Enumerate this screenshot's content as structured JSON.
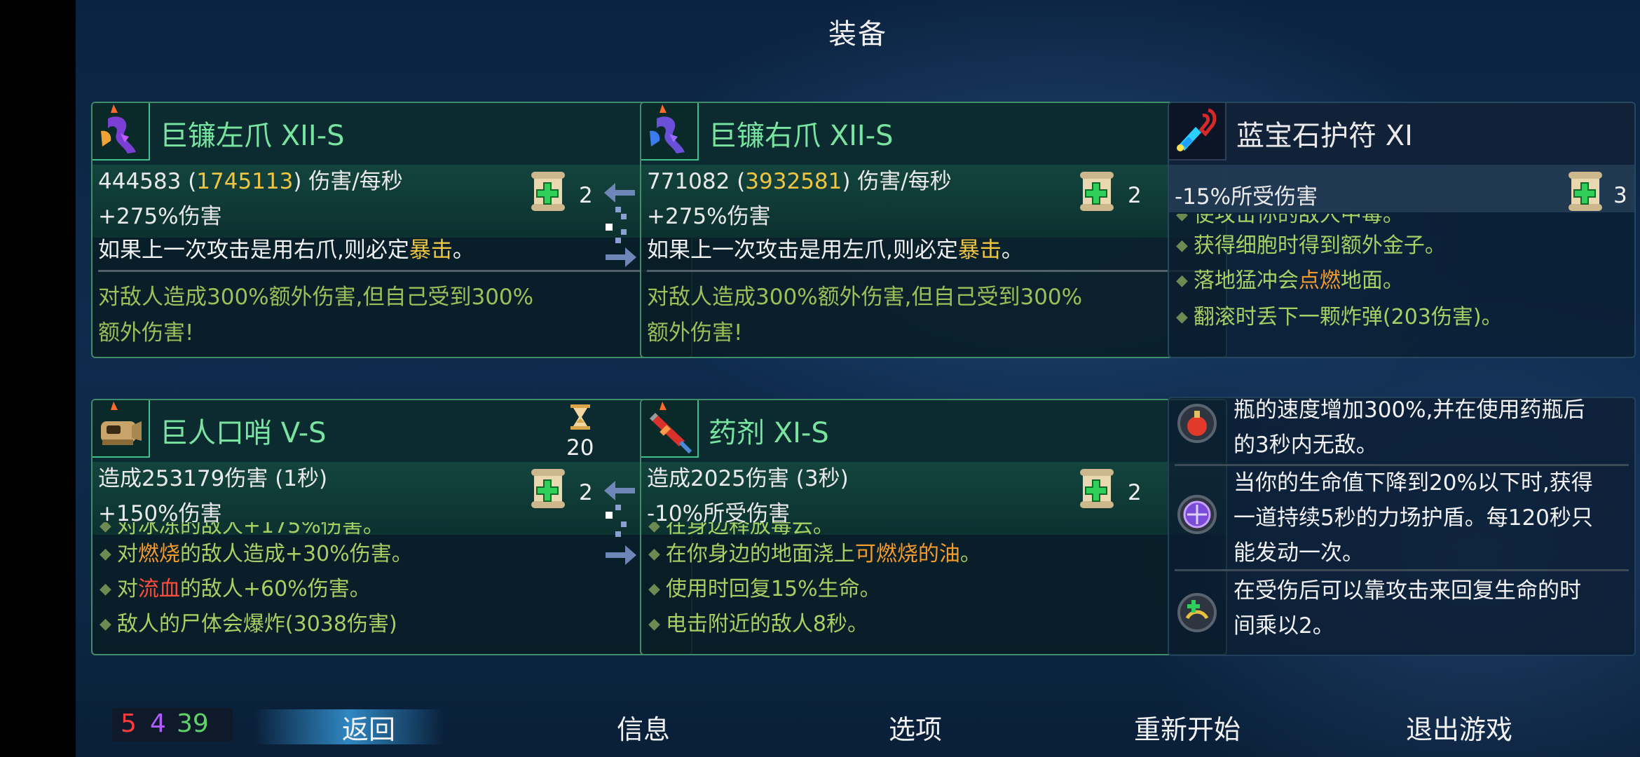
{
  "screen_title": "装备",
  "weapons": {
    "w1": {
      "name": "巨镰左爪 XII-S",
      "dps_base": "444583 (",
      "dps_crit": "1745113",
      "dps_unit": ") 伤害/每秒",
      "bonus": "+275%伤害",
      "desc_pre": "如果上一次攻击是用右爪,则必定",
      "desc_kw": "暴击",
      "desc_post": "。",
      "extra_line1": "对敌人造成300%额外伤害,但自己受到300%",
      "extra_line2": "额外伤害!",
      "scroll_count": "2"
    },
    "w2": {
      "name": "巨镰右爪 XII-S",
      "dps_base": "771082 (",
      "dps_crit": "3932581",
      "dps_unit": ") 伤害/每秒",
      "bonus": "+275%伤害",
      "desc_pre": "如果上一次攻击是用左爪,则必定",
      "desc_kw": "暴击",
      "desc_post": "。",
      "extra_line1": "对敌人造成300%额外伤害,但自己受到300%",
      "extra_line2": "额外伤害!",
      "scroll_count": "2"
    }
  },
  "amulet": {
    "name": "蓝宝石护符 XI",
    "stat": "-15%所受伤害",
    "scroll_count": "3",
    "line0": "使攻击你的敌人中毒。",
    "line1": "获得细胞时得到额外金子。",
    "line2_pre": "落地猛冲会",
    "line2_kw": "点燃",
    "line2_post": "地面。",
    "line3": "翻滚时丢下一颗炸弹(203伤害)。"
  },
  "skills": {
    "s1": {
      "name": "巨人口哨 V-S",
      "cooldown": "20",
      "stat1": "造成253179伤害 (1秒)",
      "stat2": "+150%伤害",
      "scroll_count": "2",
      "line0": "对冰冻的敌人+175%伤害。",
      "line1_pre": "对",
      "line1_kw": "燃烧",
      "line1_post": "的敌人造成+30%伤害。",
      "line2_pre": "对",
      "line2_kw": "流血",
      "line2_post": "的敌人+60%伤害。",
      "line3": "敌人的尸体会爆炸(3038伤害)"
    },
    "s2": {
      "name": "药剂 XI-S",
      "stat1": "造成2025伤害 (3秒)",
      "stat2": "-10%所受伤害",
      "scroll_count": "2",
      "line0": "在身边释放毒云。",
      "line1_pre": "在你身边的地面浇上",
      "line1_kw": "可燃烧的油",
      "line1_post": "。",
      "line2": "使用时回复15%生命。",
      "line3": "电击附近的敌人8秒。"
    }
  },
  "mutations": {
    "m1_line1": "瓶的速度增加300%,并在使用药瓶后",
    "m1_line2": "的3秒内无敌。",
    "m2_line1": "当你的生命值下降到20%以下时,获得",
    "m2_line2": "一道持续5秒的力场护盾。每120秒只",
    "m2_line3": "能发动一次。",
    "m3_line1": "在受伤后可以靠攻击来回复生命的时",
    "m3_line2": "间乘以2。"
  },
  "scrolls": {
    "brutality": "5",
    "tactics": "4",
    "survival": "39"
  },
  "menu": {
    "back": "返回",
    "info": "信息",
    "options": "选项",
    "restart": "重新开始",
    "quit": "退出游戏"
  },
  "colors": {
    "brutality": "#ff3b3b",
    "tactics": "#b05cff",
    "survival": "#5fd36a",
    "item_name": "#78e49f",
    "keyword_yellow": "#f0c542",
    "keyword_orange": "#f39a2c"
  }
}
